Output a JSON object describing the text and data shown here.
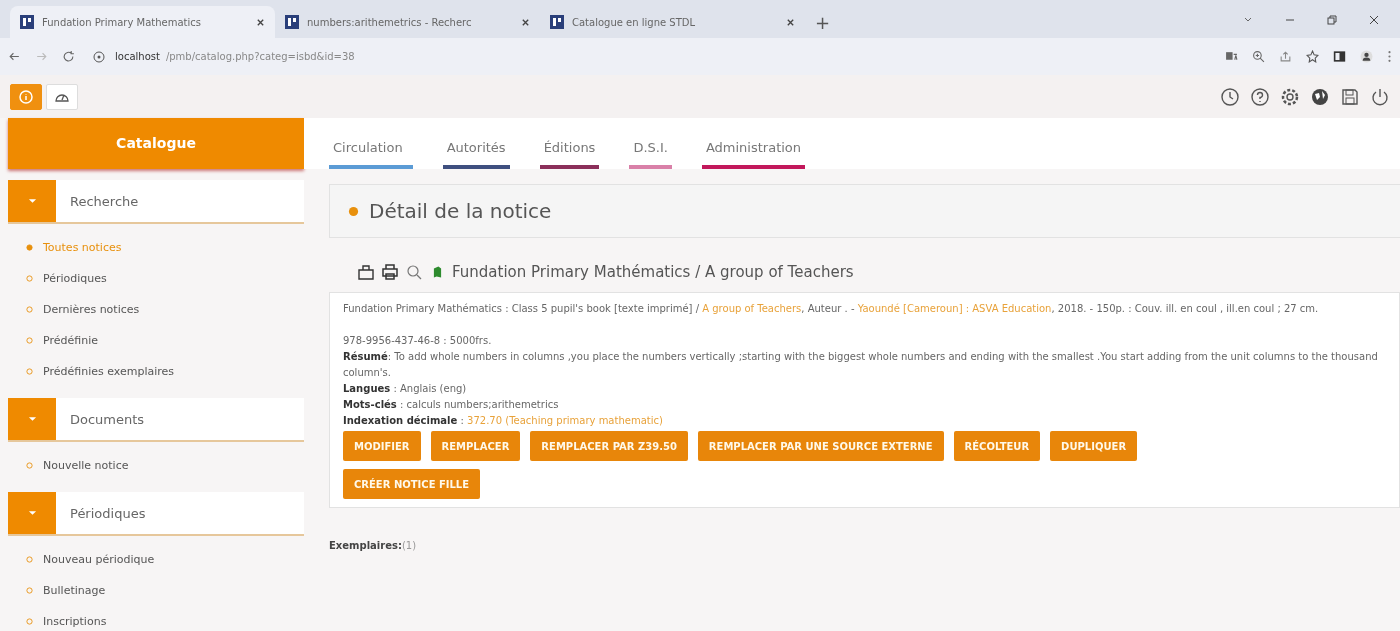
{
  "browser": {
    "tabs": [
      {
        "title": "Fundation Primary Mathematics",
        "selected": true
      },
      {
        "title": "numbers:arithemetrics - Recherc",
        "selected": false
      },
      {
        "title": "Catalogue en ligne STDL",
        "selected": false
      }
    ],
    "new_tab": "+",
    "address": {
      "host": "localhost",
      "path": "/pmb/catalog.php?categ=isbd&id=38"
    }
  },
  "sidebar": {
    "title": "Catalogue",
    "sections": [
      {
        "title": "Recherche",
        "items": [
          {
            "label": "Toutes notices",
            "selected": true
          },
          {
            "label": "Périodiques",
            "selected": false
          },
          {
            "label": "Dernières notices",
            "selected": false
          },
          {
            "label": "Prédéfinie",
            "selected": false
          },
          {
            "label": "Prédéfinies exemplaires",
            "selected": false
          }
        ]
      },
      {
        "title": "Documents",
        "items": [
          {
            "label": "Nouvelle notice",
            "selected": false
          }
        ]
      },
      {
        "title": "Périodiques",
        "items": [
          {
            "label": "Nouveau périodique",
            "selected": false
          },
          {
            "label": "Bulletinage",
            "selected": false
          },
          {
            "label": "Inscriptions",
            "selected": false
          }
        ]
      }
    ]
  },
  "nav_tabs": [
    {
      "label": "Circulation",
      "color": "#5b9bd5"
    },
    {
      "label": "Autorités",
      "color": "#3f4f7f"
    },
    {
      "label": "Éditions",
      "color": "#8b2f5a"
    },
    {
      "label": "D.S.I.",
      "color": "#d980a8"
    },
    {
      "label": "Administration",
      "color": "#c2185b"
    }
  ],
  "panel_title": "Détail de la notice",
  "record_title": "Fundation Primary Mathématics / A group of Teachers",
  "isbd": [
    {
      "text": "Fundation Primary Mathématics : Class 5 pupil's book [texte imprimé] / ",
      "link": false
    },
    {
      "text": "A group of Teachers",
      "link": true
    },
    {
      "text": ", Auteur . - ",
      "link": false
    },
    {
      "text": "Yaoundé [Cameroun] : ASVA Education",
      "link": true
    },
    {
      "text": ", 2018. - 150p. : Couv. ill. en coul , ill.en coul ; 27 cm.",
      "link": false
    }
  ],
  "isbn": "978-9956-437-46-8 : 5000frs.",
  "fields": [
    {
      "label": "Résumé",
      "sep": ": ",
      "value": "To add whole numbers in columns ,you place the numbers vertically ;starting with the biggest whole numbers and ending with the smallest .You start adding from the unit columns to the thousand column's.",
      "link": false
    },
    {
      "label": "Langues",
      "sep": " : ",
      "value": "Anglais (eng)",
      "link": false
    },
    {
      "label": "Mots-clés",
      "sep": " : ",
      "value": "calculs numbers;arithemetrics",
      "link": false
    },
    {
      "label": "Indexation décimale",
      "sep": " : ",
      "value": "372.70 (Teaching primary mathematic)",
      "link": true
    }
  ],
  "buttons": [
    "MODIFIER",
    "REMPLACER",
    "REMPLACER PAR Z39.50",
    "REMPLACER PAR UNE SOURCE EXTERNE",
    "RÉCOLTEUR",
    "DUPLIQUER",
    "CRÉER NOTICE FILLE"
  ],
  "exemplaires": {
    "label": "Exemplaires:",
    "count": "(1)"
  }
}
